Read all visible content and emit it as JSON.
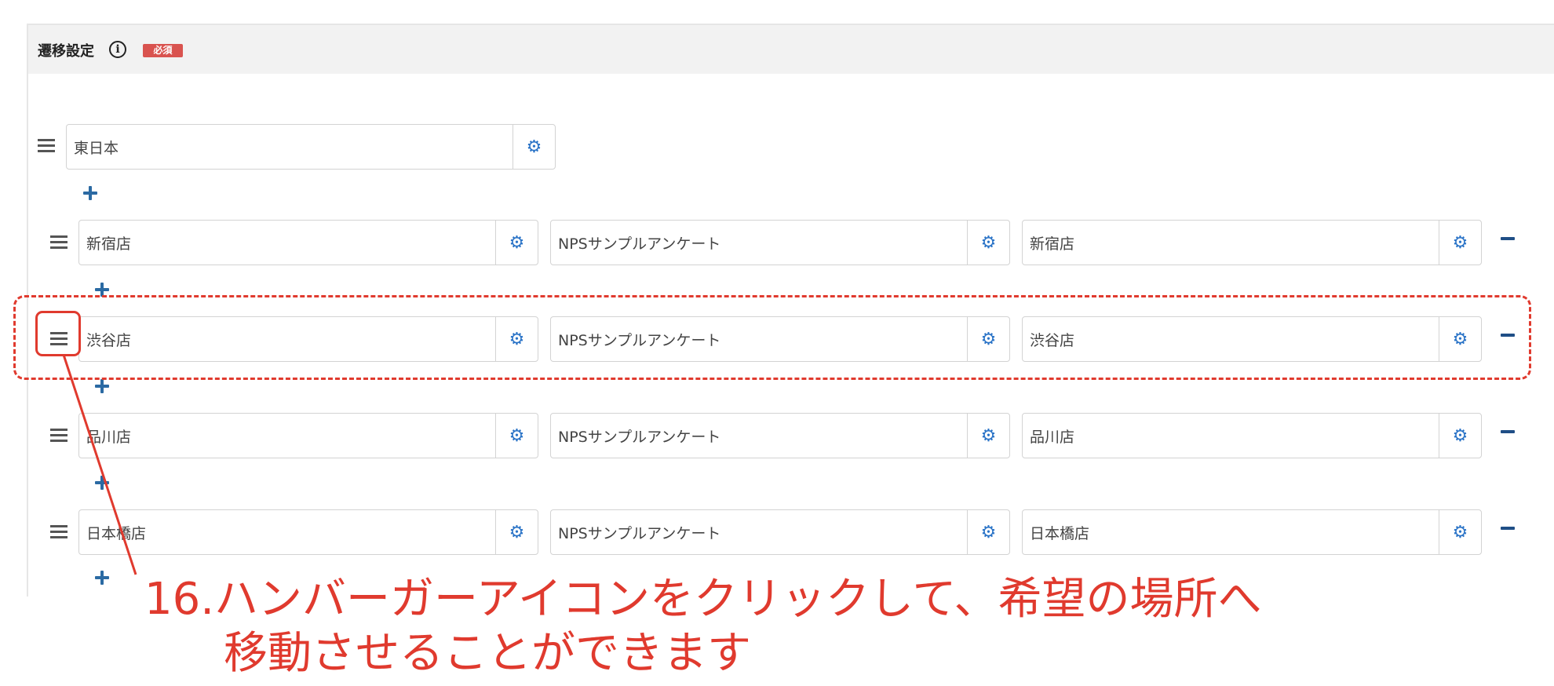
{
  "header": {
    "title": "遷移設定",
    "info_icon": "info-circle-icon",
    "required_badge": "必須"
  },
  "colors": {
    "accent_blue": "#2b74c7",
    "required_red": "#d9534f",
    "annotation_red": "#e03a2e"
  },
  "parent": {
    "value": "東日本"
  },
  "rows": [
    {
      "col1": "新宿店",
      "col2": "NPSサンプルアンケート",
      "col3": "新宿店"
    },
    {
      "col1": "渋谷店",
      "col2": "NPSサンプルアンケート",
      "col3": "渋谷店"
    },
    {
      "col1": "品川店",
      "col2": "NPSサンプルアンケート",
      "col3": "品川店"
    },
    {
      "col1": "日本橋店",
      "col2": "NPSサンプルアンケート",
      "col3": "日本橋店"
    }
  ],
  "annotation": {
    "line1": "16.ハンバーガーアイコンをクリックして、希望の場所へ",
    "line2": "移動させることができます"
  }
}
